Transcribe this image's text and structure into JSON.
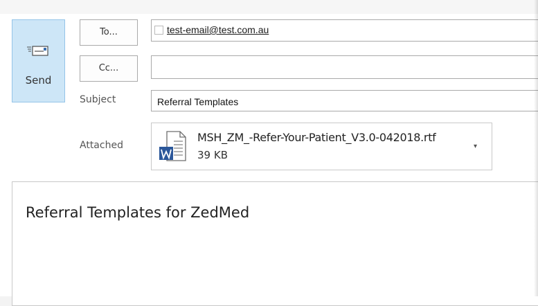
{
  "send": {
    "label": "Send",
    "icon": "send-envelope-icon"
  },
  "to": {
    "button_label": "To...",
    "recipients": [
      "test-email@test.com.au"
    ]
  },
  "cc": {
    "button_label": "Cc...",
    "value": ""
  },
  "subject": {
    "label": "Subject",
    "value": "Referral Templates"
  },
  "attached": {
    "label": "Attached",
    "file": {
      "name": "MSH_ZM_-Refer-Your-Patient_V3.0-042018.rtf",
      "size": "39 KB",
      "icon": "word-document-icon"
    }
  },
  "body": {
    "text": "Referral Templates for ZedMed"
  },
  "colors": {
    "send_bg": "#cde6f7",
    "send_border": "#94c4e8",
    "word_blue": "#2b579a"
  }
}
